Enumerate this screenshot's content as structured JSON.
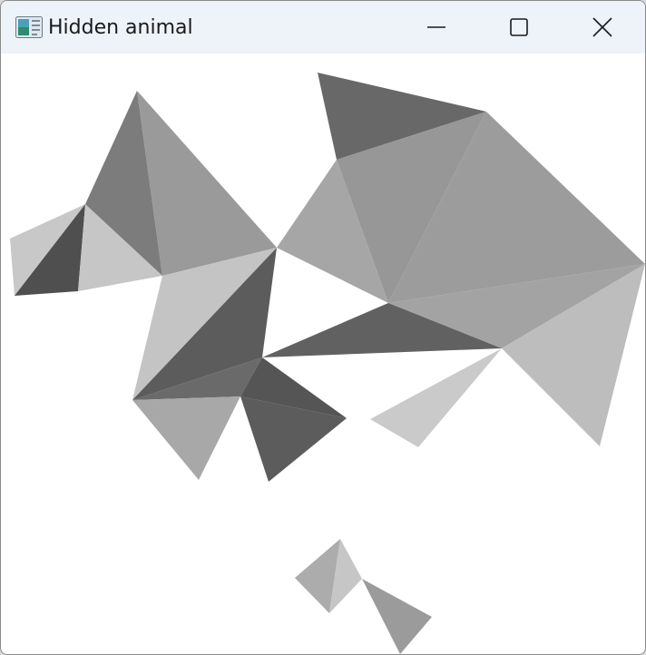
{
  "window": {
    "title": "Hidden animal",
    "app_icon": "app-window-icon",
    "controls": {
      "minimize_icon": "minimize-icon",
      "maximize_icon": "maximize-icon",
      "close_icon": "close-icon"
    }
  },
  "canvas": {
    "background": "#ffffff",
    "shade_colors": [
      "#c8c8c8",
      "#c4c4c4",
      "#bdbdbd",
      "#a9a9a9",
      "#9c9c9c",
      "#8c8c8c",
      "#7c7c7c",
      "#6a6a6a",
      "#5e5e5e",
      "#555555",
      "#4c4c4c"
    ]
  }
}
